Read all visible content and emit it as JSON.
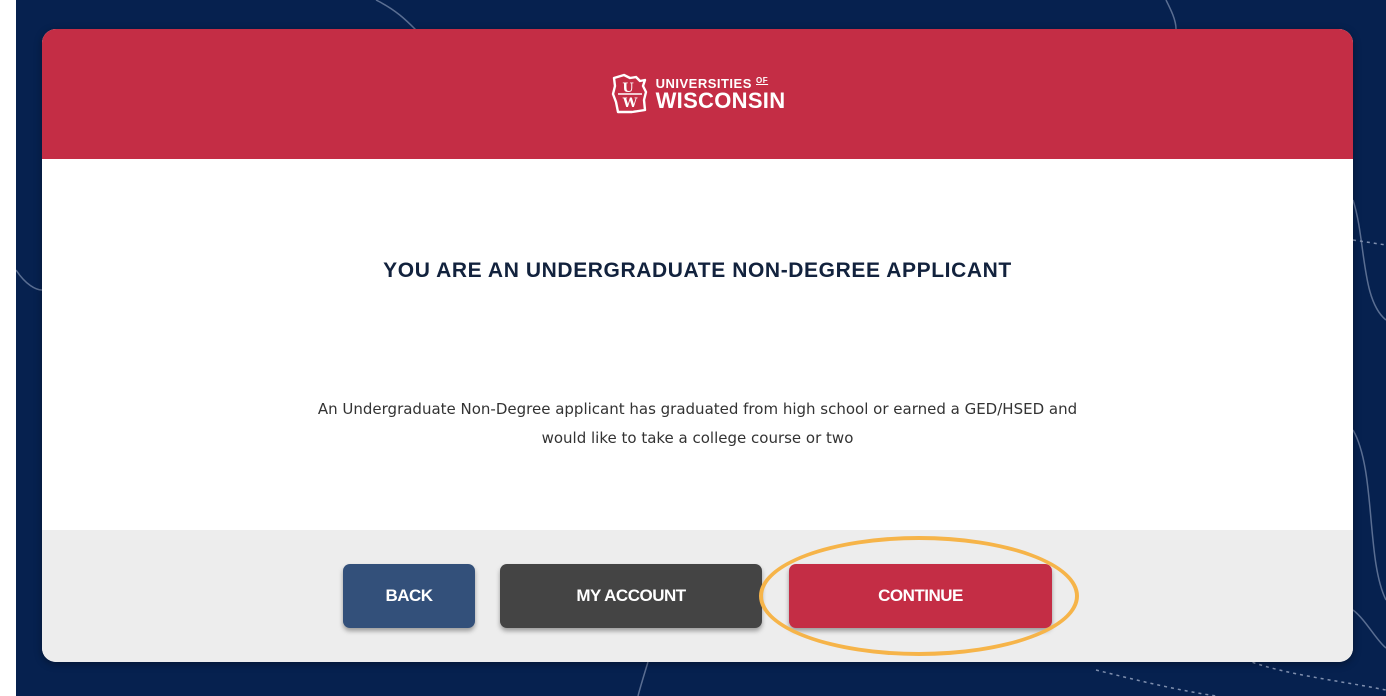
{
  "brand": {
    "logo_line1": "UNIVERSITIES",
    "logo_of": "OF",
    "logo_line2": "WISCONSIN",
    "monogram_top": "U",
    "monogram_bottom": "W",
    "header_color": "#c42d45"
  },
  "main": {
    "heading": "YOU ARE AN UNDERGRADUATE NON-DEGREE APPLICANT",
    "description_line1": "An Undergraduate Non-Degree applicant has graduated from high school or earned a GED/HSED and",
    "description_line2": "would like to take a college course or two"
  },
  "footer": {
    "back_label": "BACK",
    "account_label": "MY ACCOUNT",
    "continue_label": "CONTINUE"
  },
  "colors": {
    "background": "#06214f",
    "back_button": "#33507a",
    "account_button": "#444444",
    "continue_button": "#c42d45",
    "highlight": "#f6b449"
  }
}
